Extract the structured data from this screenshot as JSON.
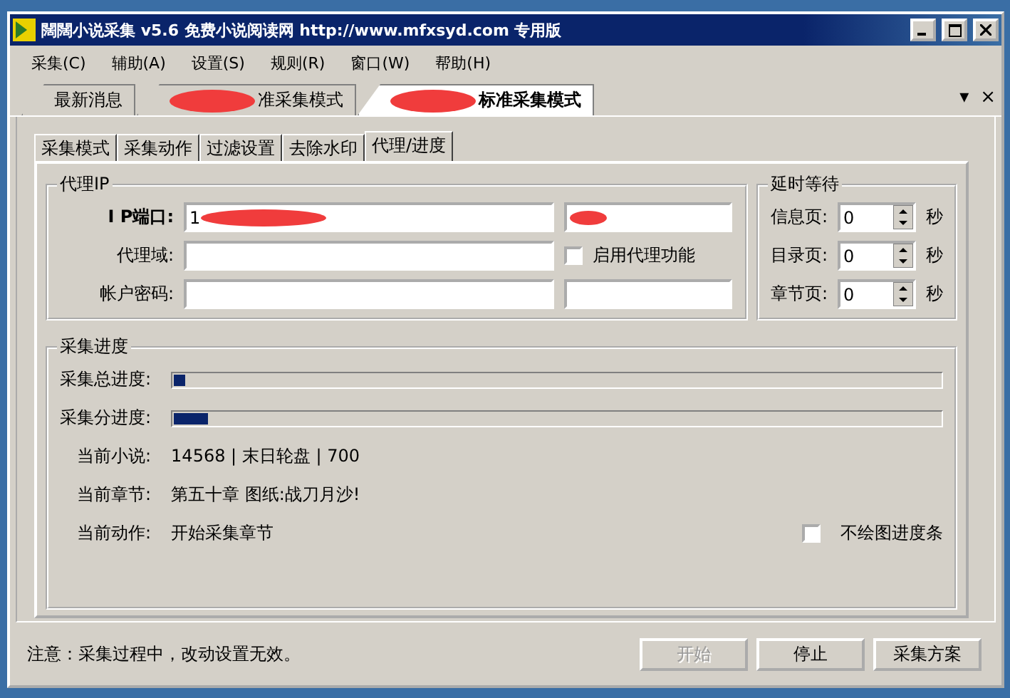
{
  "window": {
    "title": "闊闊小说采集 v5.6 免费小说阅读网 http://www.mfxsyd.com 专用版"
  },
  "menu": [
    "采集(C)",
    "辅助(A)",
    "设置(S)",
    "规则(R)",
    "窗口(W)",
    "帮助(H)"
  ],
  "doc_tabs": [
    {
      "label": "最新消息",
      "selected": false,
      "redacted": false
    },
    {
      "label": "准采集模式",
      "selected": false,
      "redacted": true
    },
    {
      "label": "标准采集模式",
      "selected": true,
      "redacted": true
    }
  ],
  "doc_tab_controls": [
    "▾",
    "×"
  ],
  "page_tabs": [
    {
      "label": "采集模式",
      "selected": false
    },
    {
      "label": "采集动作",
      "selected": false
    },
    {
      "label": "过滤设置",
      "selected": false
    },
    {
      "label": "去除水印",
      "selected": false
    },
    {
      "label": "代理/进度",
      "selected": true
    }
  ],
  "proxy": {
    "title": "代理IP",
    "ip_label": "I P端口:",
    "ip_value": "1",
    "ip_redacted": true,
    "port_redacted": true,
    "domain_label": "代理域:",
    "enable": {
      "label": "启用代理功能",
      "checked": false
    },
    "account_label": "帐户密码:"
  },
  "delay": {
    "title": "延时等待",
    "rows": [
      {
        "label": "信息页:",
        "value": "0",
        "unit": "秒"
      },
      {
        "label": "目录页:",
        "value": "0",
        "unit": "秒"
      },
      {
        "label": "章节页:",
        "value": "0",
        "unit": "秒"
      }
    ]
  },
  "progress": {
    "title": "采集进度",
    "bars": [
      {
        "label": "采集总进度:",
        "level": 0.015
      },
      {
        "label": "采集分进度:",
        "level": 0.045
      }
    ],
    "info": [
      {
        "label": "当前小说:",
        "value": "14568 | 末日轮盘 | 700"
      },
      {
        "label": "当前章节:",
        "value": "第五十章 图纸:战刀月沙!"
      },
      {
        "label": "当前动作:",
        "value": "开始采集章节"
      }
    ],
    "no_draw": {
      "label": "不绘图进度条",
      "checked": false
    }
  },
  "notice": "注意：采集过程中，改动设置无效。",
  "buttons": [
    {
      "label": "开始",
      "disabled": true
    },
    {
      "label": "停止",
      "disabled": false
    },
    {
      "label": "采集方案",
      "disabled": false
    }
  ]
}
